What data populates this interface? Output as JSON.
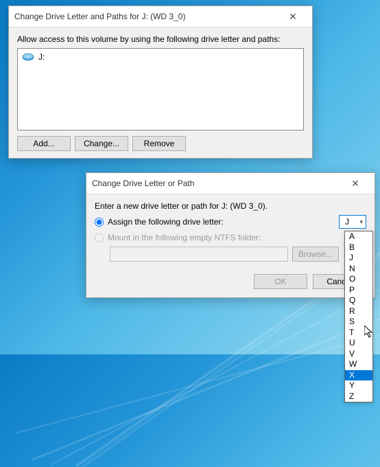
{
  "dialog1": {
    "title": "Change Drive Letter and Paths for J: (WD 3_0)",
    "instruction": "Allow access to this volume by using the following drive letter and paths:",
    "item_label": "J:",
    "add": "Add...",
    "change": "Change...",
    "remove": "Remove"
  },
  "dialog2": {
    "title": "Change Drive Letter or Path",
    "instruction": "Enter a new drive letter or path for J: (WD 3_0).",
    "assign_label": "Assign the following drive letter:",
    "mount_label": "Mount in the following empty NTFS folder:",
    "selected_letter": "J",
    "browse": "Browse...",
    "ok": "OK",
    "cancel": "Cancel"
  },
  "dropdown": {
    "options": [
      "A",
      "B",
      "J",
      "N",
      "O",
      "P",
      "Q",
      "R",
      "S",
      "T",
      "U",
      "V",
      "W",
      "X",
      "Y",
      "Z"
    ],
    "highlighted": "X"
  }
}
